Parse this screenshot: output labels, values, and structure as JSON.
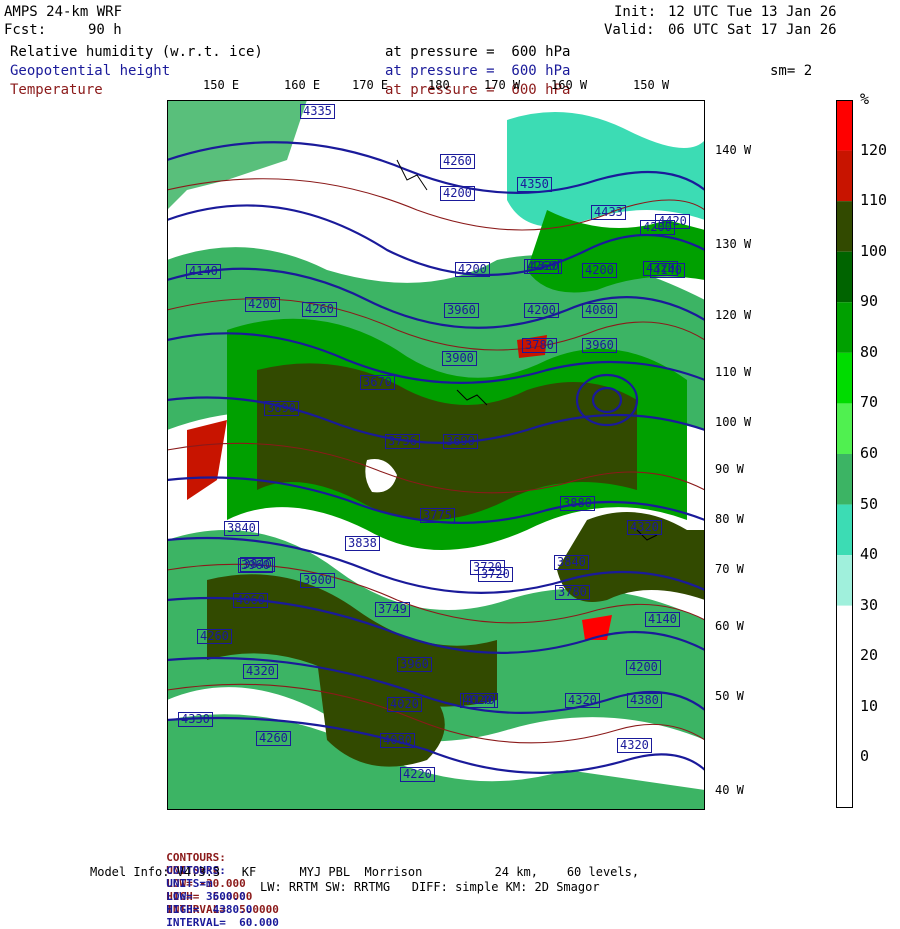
{
  "header": {
    "model": "AMPS 24-km WRF",
    "init_label": "Init:",
    "init_value": "12 UTC Tue 13 Jan 26",
    "fcst_label": "Fcst:",
    "fcst_value": "90 h",
    "valid_label": "Valid:",
    "valid_value": "06 UTC Sat 17 Jan 26",
    "fields": [
      {
        "name": "Relative humidity (w.r.t. ice)",
        "pressure": "at pressure =  600 hPa",
        "color": "#000000"
      },
      {
        "name": "Geopotential height",
        "pressure": "at pressure =  600 hPa",
        "color": "#1a1a9a"
      },
      {
        "name": "Temperature",
        "pressure": "at pressure =  600 hPa",
        "color": "#8b1a1a"
      }
    ],
    "smoothing": "sm= 2"
  },
  "top_longitudes": [
    "150 E",
    "160 E",
    "170 E",
    "180",
    "170 W",
    "160 W",
    "150 W"
  ],
  "right_longitudes": [
    "140 W",
    "130 W",
    "120 W",
    "110 W",
    "100 W",
    "90 W",
    "80 W",
    "70 W",
    "60 W",
    "50 W",
    "40 W"
  ],
  "height_labels": [
    "4335",
    "4260",
    "4200",
    "4350",
    "4433",
    "4420",
    "4320",
    "4200",
    "4320",
    "4260",
    "4200",
    "4140",
    "4080",
    "4200",
    "4140",
    "4200",
    "4260",
    "4200",
    "3960",
    "3900",
    "3780",
    "3960",
    "3670",
    "3840",
    "3690",
    "3736",
    "3690",
    "3720",
    "3840",
    "3960",
    "4060",
    "3900",
    "3840",
    "3780",
    "3720",
    "3749",
    "3960",
    "4020",
    "4080",
    "4020",
    "4140",
    "4220",
    "4260",
    "4320",
    "4330",
    "4260",
    "4320",
    "4380",
    "4320",
    "3880",
    "3775",
    "3838",
    "4200",
    "4140",
    "4320"
  ],
  "colorbar": {
    "unit": "%",
    "ticks": [
      "120",
      "110",
      "100",
      "90",
      "80",
      "70",
      "60",
      "50",
      "40",
      "30",
      "20",
      "10",
      "0"
    ],
    "colors": [
      "#ff0000",
      "#c81400",
      "#324a00",
      "#006400",
      "#00a000",
      "#00dc00",
      "#50f050",
      "#3cb464",
      "#3cdcb4",
      "#a0f0dc",
      "#ffffff",
      "#ffffff",
      "#ffffff"
    ]
  },
  "footer": {
    "temp_contours": {
      "label": "CONTOURS:",
      "units": "UNITS=°C",
      "low": "LOW= -30.000",
      "high": "HIGH=  5.0000",
      "interval": "INTERVAL=  5.0000",
      "color": "#8b1a1a"
    },
    "height_contours": {
      "label": "CONTOURS:",
      "units": "UNITS=m",
      "low": "LOW=  3600.0",
      "high": "HIGH=  4380.0",
      "interval": "INTERVAL=  60.000",
      "color": "#1a1a9a"
    },
    "model_info_1": "Model Info: V4.3.3   KF      MYJ PBL  Morrison          24 km,    60 levels,",
    "model_info_2": "LW: RRTM SW: RRTMG   DIFF: simple KM: 2D Smagor"
  }
}
